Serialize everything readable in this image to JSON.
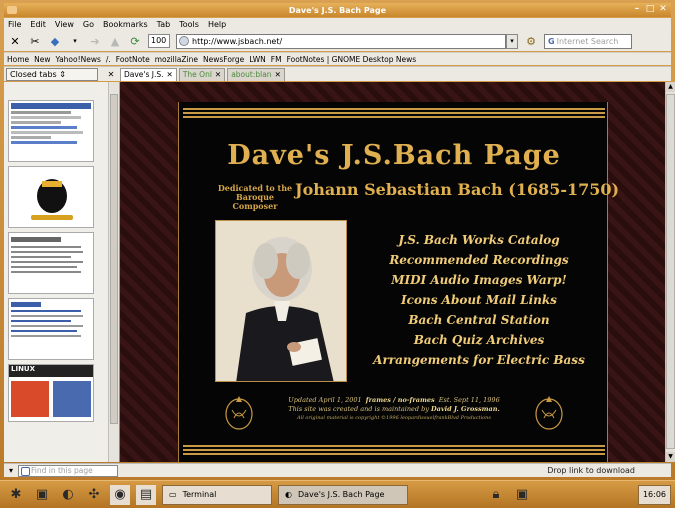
{
  "window": {
    "title": "Dave's J.S. Bach Page"
  },
  "menubar": {
    "items": [
      "File",
      "Edit",
      "View",
      "Go",
      "Bookmarks",
      "Tab",
      "Tools",
      "Help"
    ]
  },
  "navbar": {
    "zoom": "100",
    "url": "http://www.jsbach.net/",
    "search_placeholder": "Internet Search"
  },
  "bookmarks": {
    "items": [
      "Home",
      "New",
      "Yahoo!News",
      "/.",
      "FootNote",
      "mozillaZine",
      "NewsForge",
      "LWN",
      "FM",
      "FootNotes | GNOME Desktop News"
    ]
  },
  "tabs": {
    "closed_label": "Closed tabs",
    "items": [
      "Dave's J.S.",
      "The Onl",
      "about:blan"
    ]
  },
  "page": {
    "title": "Dave's J.S.Bach Page",
    "dedication_small": "Dedicated to the Baroque Composer",
    "dedication_name": "Johann Sebastian Bach (1685-1750)",
    "links": [
      "J.S. Bach Works Catalog",
      "Recommended Recordings",
      "MIDI Audio Images Warp!",
      "Icons About Mail Links",
      "Bach Central Station",
      "Bach Quiz Archives",
      "Arrangements for Electric Bass"
    ],
    "footer_line1": "Updated April 1, 2001",
    "footer_frames": "frames / no-frames",
    "footer_est": "Est. Sept 11, 1996",
    "footer_line2": "This site was created and is maintained by",
    "footer_author": "David J. Grossman.",
    "footer_line3": "All original material is copyright ©1996 leopardissuelfrankBlvd Productions"
  },
  "findbar": {
    "placeholder": "Find in this page",
    "status": "Drop link to download"
  },
  "taskbar": {
    "terminal": "Terminal",
    "browser": "Dave's J.S. Bach Page",
    "clock": "16:06"
  }
}
